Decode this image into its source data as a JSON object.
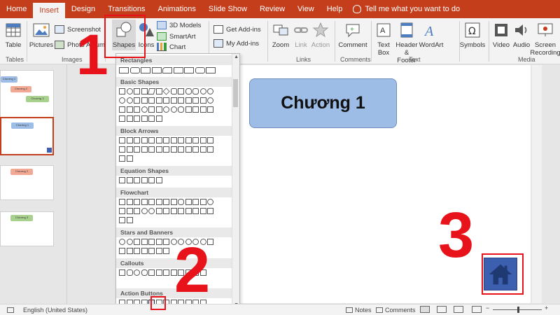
{
  "tabs": [
    {
      "label": "Home"
    },
    {
      "label": "Insert"
    },
    {
      "label": "Design"
    },
    {
      "label": "Transitions"
    },
    {
      "label": "Animations"
    },
    {
      "label": "Slide Show"
    },
    {
      "label": "Review"
    },
    {
      "label": "View"
    },
    {
      "label": "Help"
    }
  ],
  "tell_me": "Tell me what you want to do",
  "ribbon": {
    "table": "Table",
    "pictures": "Pictures",
    "screenshot": "Screenshot",
    "photo_album": "Photo Album",
    "shapes": "Shapes",
    "icons": "Icons",
    "models_3d": "3D Models",
    "smartart": "SmartArt",
    "chart": "Chart",
    "get_addins": "Get Add-ins",
    "my_addins": "My Add-ins",
    "zoom": "Zoom",
    "link": "Link",
    "action": "Action",
    "comment": "Comment",
    "text_box": "Text Box",
    "header_footer": "Header & Footer",
    "wordart": "WordArt",
    "symbols": "Symbols",
    "video": "Video",
    "audio": "Audio",
    "screen_recording": "Screen Recording",
    "groups": {
      "tables": "Tables",
      "images": "Images",
      "links": "Links",
      "comments": "Comments",
      "text": "Text",
      "media": "Media"
    }
  },
  "shapes_panel": {
    "categories": [
      {
        "name": "Rectangles"
      },
      {
        "name": "Basic Shapes"
      },
      {
        "name": "Block Arrows"
      },
      {
        "name": "Equation Shapes"
      },
      {
        "name": "Flowchart"
      },
      {
        "name": "Stars and Banners"
      },
      {
        "name": "Callouts"
      },
      {
        "name": "Action Buttons"
      }
    ]
  },
  "thumbnails": {
    "t1_a": "Chương 1",
    "t1_b": "Chương 2",
    "t1_c": "Chương 3",
    "t2": "Chương 1",
    "t3": "Chương 2",
    "t4": "Chương 3"
  },
  "slide": {
    "title": "Chương 1"
  },
  "status": {
    "language": "English (United States)",
    "notes": "Notes",
    "comments": "Comments"
  },
  "annotations": {
    "step1": "1",
    "step2": "2",
    "step3": "3"
  },
  "colors": {
    "accent": "#c43e1c",
    "annotation": "#e8121b",
    "shape_fill": "#9dbde6",
    "home_button": "#3d5fb0"
  }
}
